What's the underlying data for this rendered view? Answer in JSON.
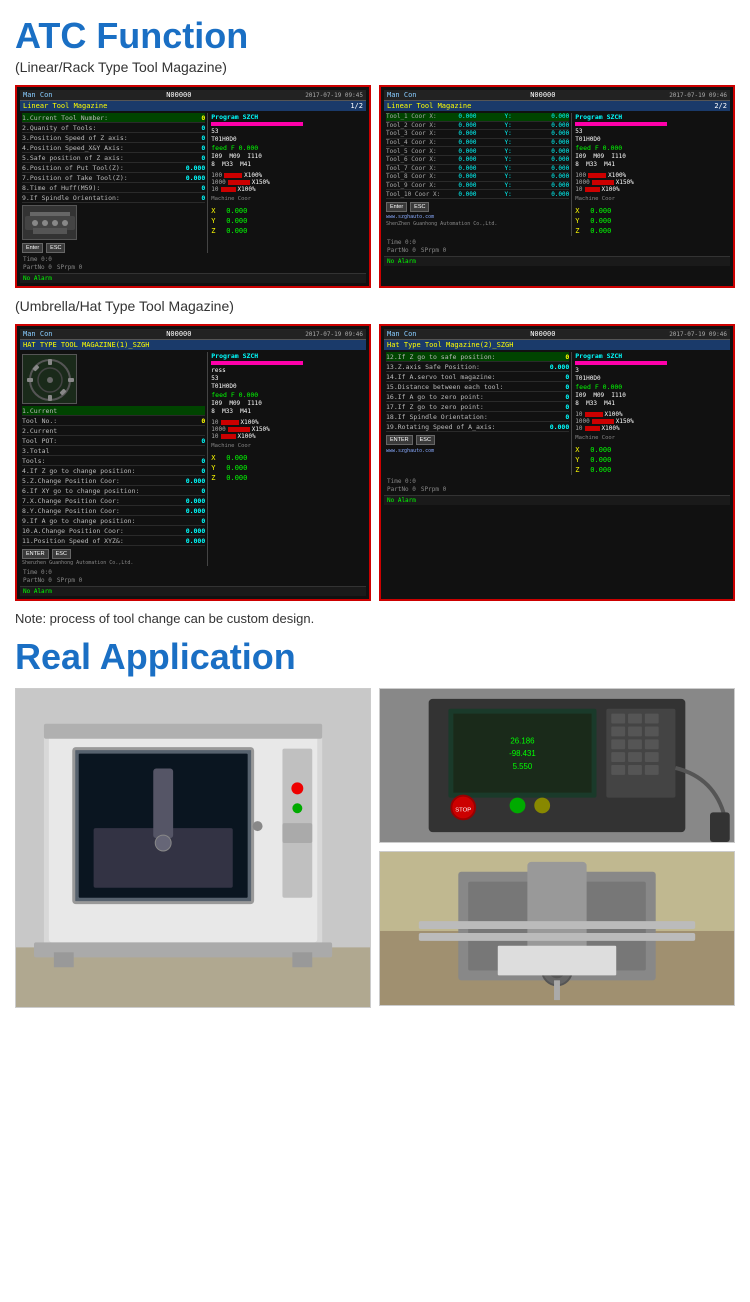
{
  "page": {
    "atc_title": "ATC Function",
    "subtitle1": "(Linear/Rack Type Tool Magazine)",
    "subtitle2": "(Umbrella/Hat Type Tool Magazine)",
    "note": "Note: process of tool change can be custom design.",
    "real_app_title": "Real Application"
  },
  "screens": {
    "linear_1": {
      "mode": "Man Con",
      "program_num": "N00000",
      "datetime": "2017-07-19  09:45",
      "tab": "Linear Tool Magazine",
      "page": "1/2",
      "program_name": "SZCH",
      "rows": [
        {
          "label": "1.Current Tool Number:",
          "value": "0",
          "highlight": true
        },
        {
          "label": "2.Quanity of Tools:",
          "value": "0"
        },
        {
          "label": "3.Position Speed of Z axis:",
          "value": "0"
        },
        {
          "label": "4.Position Speed_X&Y Axis:",
          "value": "0"
        },
        {
          "label": "5.Safe position of Z axis:",
          "value": "0.000"
        },
        {
          "label": "6.Position of Put Tool(Z):",
          "value": "0.000"
        },
        {
          "label": "7.Position of Take Tool(Z):",
          "value": "0.000"
        },
        {
          "label": "8.Time of Huff(M59):",
          "value": "0"
        },
        {
          "label": "9.If Spindle Orientation:",
          "value": "0"
        }
      ],
      "prog_lines": [
        "53",
        "T01H0D0",
        "feed F 0.000",
        "109  M33  I110",
        "8  M33  M41"
      ],
      "speed_1": "X100%",
      "speed_2": "X150%",
      "speed_3": "X100%",
      "xyz": {
        "x": "0.000",
        "y": "0.000",
        "z": "0.000"
      },
      "time": "0:0",
      "partno": "0",
      "sprpm": "0",
      "no_alarm": "No Alarm"
    },
    "linear_2": {
      "mode": "Man Con",
      "program_num": "N00000",
      "datetime": "2017-07-19  09:46",
      "tab": "Linear Tool Magazine",
      "page": "2/2",
      "program_name": "SZCH",
      "tool_rows": [
        {
          "label": "Tool_1 Coor X:",
          "x": "0.000",
          "y_label": "Y:",
          "y": "0.000"
        },
        {
          "label": "Tool_2 Coor X:",
          "x": "0.000",
          "y_label": "Y:",
          "y": "0.000"
        },
        {
          "label": "Tool_3 Coor X:",
          "x": "0.000",
          "y_label": "Y:",
          "y": "0.000"
        },
        {
          "label": "Tool_4 Coor X:",
          "x": "0.000",
          "y_label": "Y:",
          "y": "0.000"
        },
        {
          "label": "Tool_5 Coor X:",
          "x": "0.000",
          "y_label": "Y:",
          "y": "0.000"
        },
        {
          "label": "Tool_6 Coor X:",
          "x": "0.000",
          "y_label": "Y:",
          "y": "0.000"
        },
        {
          "label": "Tool_7 Coor X:",
          "x": "0.000",
          "y_label": "Y:",
          "y": "0.000"
        },
        {
          "label": "Tool_8 Coor X:",
          "x": "0.000",
          "y_label": "Y:",
          "y": "0.000"
        },
        {
          "label": "Tool_9 Coor X:",
          "x": "0.000",
          "y_label": "Y:",
          "y": "0.000"
        },
        {
          "label": "Tool_10 Coor X:",
          "x": "0.000",
          "y_label": "Y:",
          "y": "0.000"
        }
      ],
      "prog_lines": [
        "53",
        "T01H0D0",
        "feed F 0.000",
        "109  M33  I110",
        "8  M33  M41"
      ],
      "speed_1": "X100%",
      "speed_2": "X150%",
      "speed_3": "X100%",
      "xyz": {
        "x": "0.000",
        "y": "0.000",
        "z": "0.000"
      },
      "time": "0:0",
      "partno": "0",
      "sprpm": "0",
      "website": "www.szghauto.com",
      "no_alarm": "No Alarm",
      "enter_btn": "Enter",
      "esc_btn": "ESC",
      "company": "ShenZhen Guanhong Automation Co.,Ltd."
    },
    "hat_1": {
      "mode": "Man Con",
      "program_num": "N00000",
      "datetime": "2017-07-19  09:46",
      "tab": "HAT TYPE TOOL MAGAZINE(1)_SZGH",
      "program_name": "SZCH",
      "rows": [
        {
          "label": "1.Current",
          "value": ""
        },
        {
          "label": "Tool No.:",
          "value": "0",
          "highlight": true
        },
        {
          "label": "2.Current",
          "value": ""
        },
        {
          "label": "Tool POT:",
          "value": "0"
        },
        {
          "label": "3.Total",
          "value": ""
        },
        {
          "label": "Tools:",
          "value": "0"
        },
        {
          "label": "4.If Z go to change position:",
          "value": "0"
        },
        {
          "label": "5.Z.Change Position Coor:",
          "value": "0.000"
        },
        {
          "label": "6.If XY go to change position:",
          "value": "0"
        },
        {
          "label": "7.X.Change Position Coor:",
          "value": "0.000"
        },
        {
          "label": "8.Y.Change Position Coor:",
          "value": "0.000"
        },
        {
          "label": "9.If A go to change position:",
          "value": "0"
        },
        {
          "label": "10.A.Change Position Coor:",
          "value": "0.000"
        },
        {
          "label": "11.Position Speed of XYZ&:",
          "value": "0.000"
        }
      ],
      "prog_lines": [
        "ress",
        "53",
        "T01H0D0",
        "feed F 0.000",
        "109  M33  I110",
        "8  M33  M41"
      ],
      "speed_1": "X100%",
      "speed_2": "X150%",
      "speed_3": "X100%",
      "xyz": {
        "x": "0.000",
        "y": "0.000",
        "z": "0.000"
      },
      "time": "0:0",
      "partno": "0",
      "sprpm": "0",
      "no_alarm": "No Alarm",
      "enter_btn": "ENTER",
      "esc_btn": "ESC",
      "company": "Shenzhen Guanhong Automation Co.,Ltd."
    },
    "hat_2": {
      "mode": "Man Con",
      "program_num": "N00000",
      "datetime": "2017-07-19  09:46",
      "tab": "Hat Type Tool Magazine(2)_SZGH",
      "program_name": "SZCH",
      "rows": [
        {
          "label": "12.If Z go to safe position:",
          "value": "0",
          "highlight": true
        },
        {
          "label": "13.Z.axis Safe Position:",
          "value": "0.000"
        },
        {
          "label": "14.If A.servo tool magazine:",
          "value": "0"
        },
        {
          "label": "15.Distance between each tool:",
          "value": "0"
        },
        {
          "label": "16.If A go to zero point:",
          "value": "0"
        },
        {
          "label": "17.If Z go to zero point:",
          "value": "0"
        },
        {
          "label": "18.If Spindle Orientation:",
          "value": "0"
        },
        {
          "label": "19.Rotating Speed of A_axis:",
          "value": "0.000"
        }
      ],
      "prog_lines": [
        "3",
        "T01H0D0",
        "feed F 0.000",
        "109  M33  I110",
        "8  M33  M41"
      ],
      "speed_1": "X100%",
      "speed_2": "X150%",
      "speed_3": "X100%",
      "xyz": {
        "x": "0.000",
        "y": "0.000",
        "z": "0.000"
      },
      "time": "0:0",
      "partno": "0",
      "sprpm": "0",
      "no_alarm": "No Alarm",
      "enter_btn": "ENTER",
      "esc_btn": "ESC",
      "website": "www.szghauto.com"
    }
  },
  "photos": {
    "photo1_alt": "CNC machine with enclosure",
    "photo2_alt": "CNC control panel",
    "photo3_alt": "CNC machine detail"
  }
}
